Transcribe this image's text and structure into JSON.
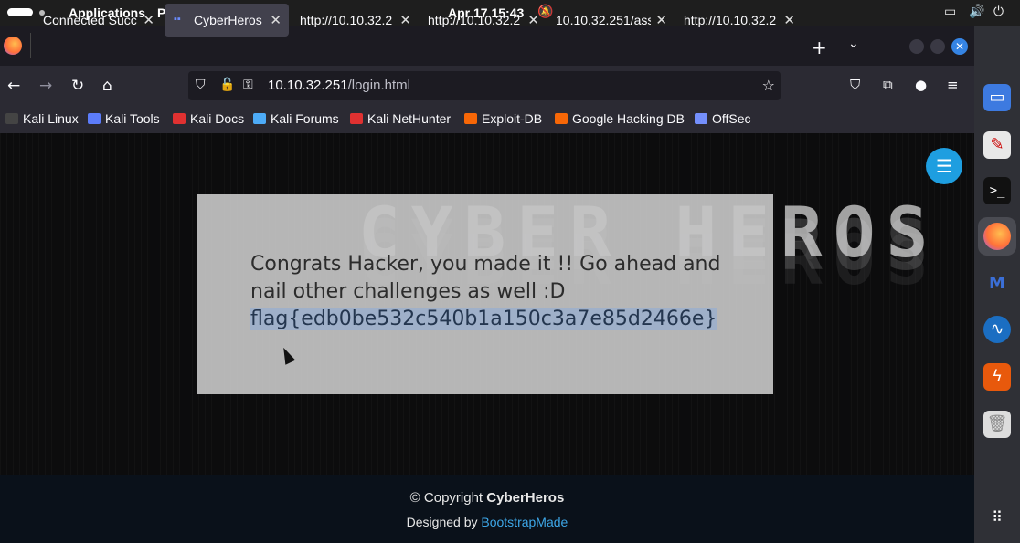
{
  "topbar": {
    "applications": "Applications",
    "places": "Places",
    "clock": "Apr 17  15:43"
  },
  "tabs": [
    {
      "label": "Connected Succ",
      "active": false
    },
    {
      "label": "CyberHeros",
      "active": true
    },
    {
      "label": "http://10.10.32.2",
      "active": false
    },
    {
      "label": "http://10.10.32.2",
      "active": false
    },
    {
      "label": "10.10.32.251/ass",
      "active": false
    },
    {
      "label": "http://10.10.32.2",
      "active": false
    }
  ],
  "urlbar": {
    "host": "10.10.32.251",
    "path": "/login.html"
  },
  "bookmarks": [
    {
      "label": "Kali Linux",
      "color": "#444444"
    },
    {
      "label": "Kali Tools",
      "color": "#5c7cfa"
    },
    {
      "label": "Kali Docs",
      "color": "#e03131"
    },
    {
      "label": "Kali Forums",
      "color": "#4dabf7"
    },
    {
      "label": "Kali NetHunter",
      "color": "#e03131"
    },
    {
      "label": "Exploit-DB",
      "color": "#f76707"
    },
    {
      "label": "Google Hacking DB",
      "color": "#f76707"
    },
    {
      "label": "OffSec",
      "color": "#748ffc"
    }
  ],
  "page": {
    "banner": "CYBER HEROS",
    "message": "Congrats Hacker, you made it !! Go ahead and nail other challenges as well :D",
    "flag": "flag{edb0be532c540b1a150c3a7e85d2466e}",
    "footer_copyright_prefix": "© Copyright ",
    "footer_brand": "CyberHeros",
    "footer_designed_prefix": "Designed by ",
    "footer_designer": "BootstrapMade"
  },
  "colors": {
    "accent": "#1e9ee0",
    "link": "#3da7e8",
    "selection": "#9fb0c9"
  }
}
